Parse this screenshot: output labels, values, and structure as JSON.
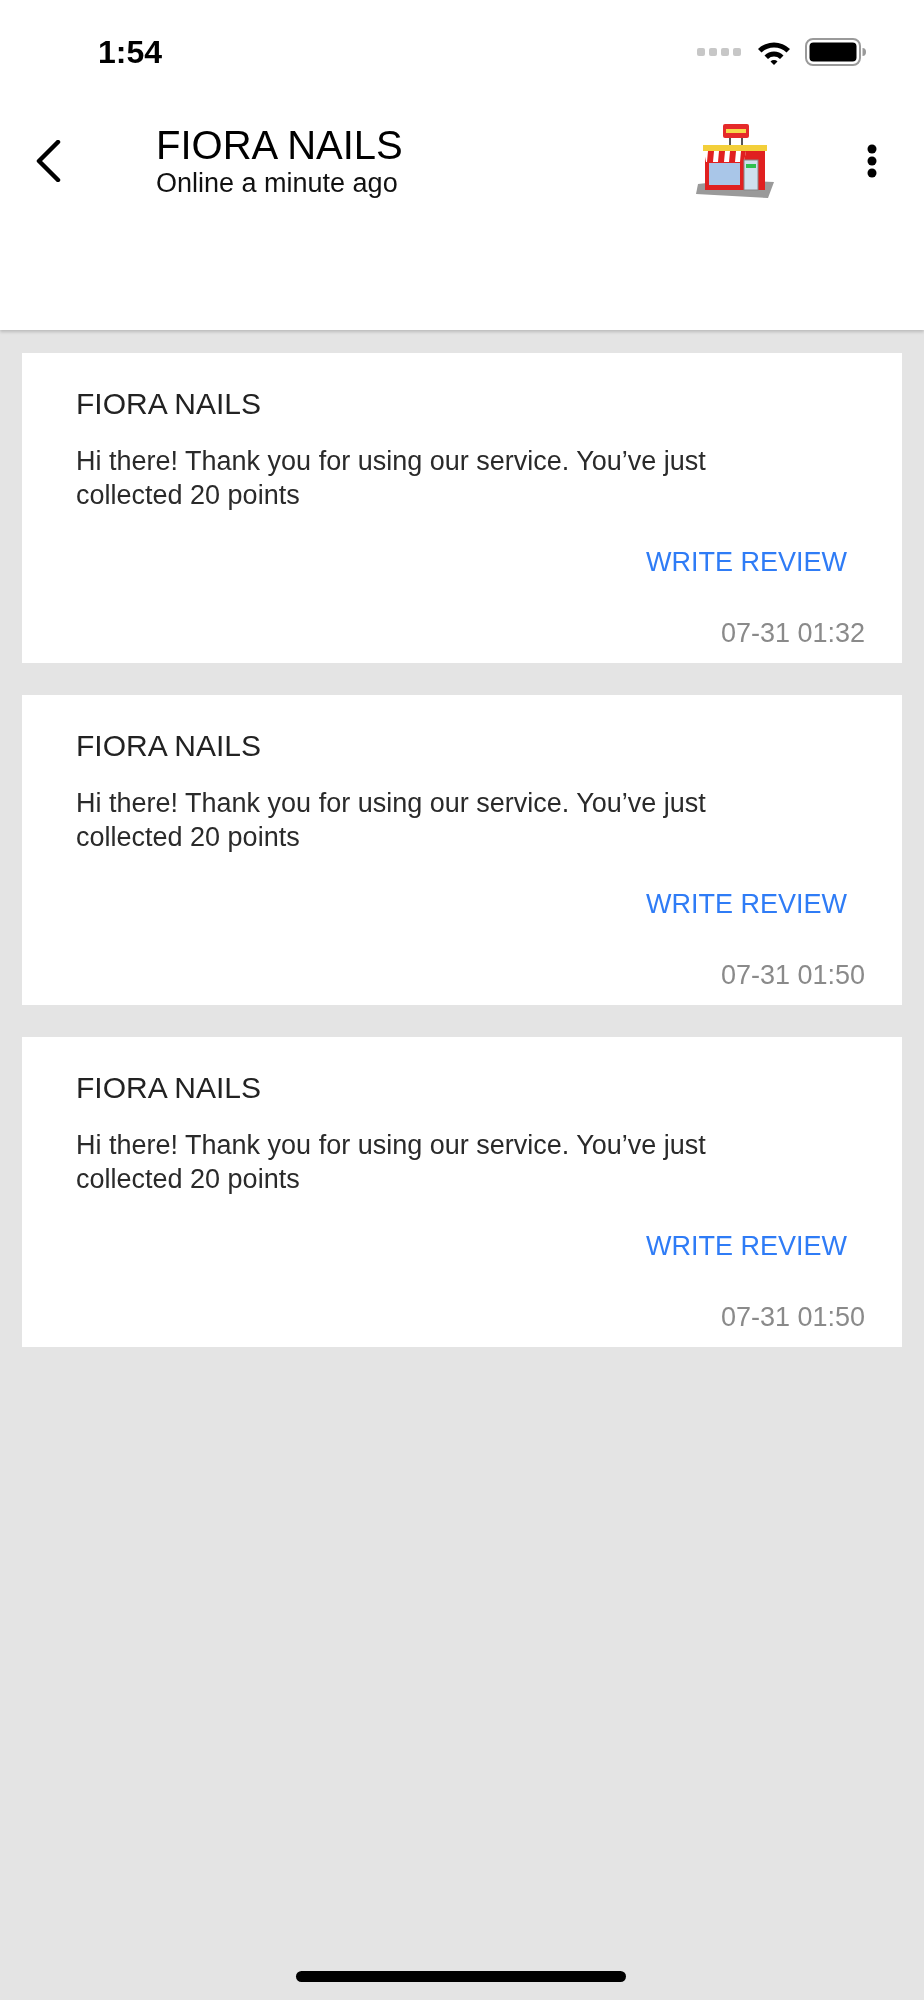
{
  "status_bar": {
    "time": "1:54"
  },
  "header": {
    "title": "FIORA NAILS",
    "subtitle": "Online a minute ago"
  },
  "messages": [
    {
      "sender": "FIORA NAILS",
      "text": "Hi there! Thank you for using our service. You’ve just collected 20 points",
      "action": "WRITE REVIEW",
      "time": "07-31 01:32"
    },
    {
      "sender": "FIORA NAILS",
      "text": "Hi there! Thank you for using our service. You’ve just collected 20 points",
      "action": "WRITE REVIEW",
      "time": "07-31 01:50"
    },
    {
      "sender": "FIORA NAILS",
      "text": "Hi there! Thank you for using our service. You’ve just collected 20 points",
      "action": "WRITE REVIEW",
      "time": "07-31 01:50"
    }
  ]
}
